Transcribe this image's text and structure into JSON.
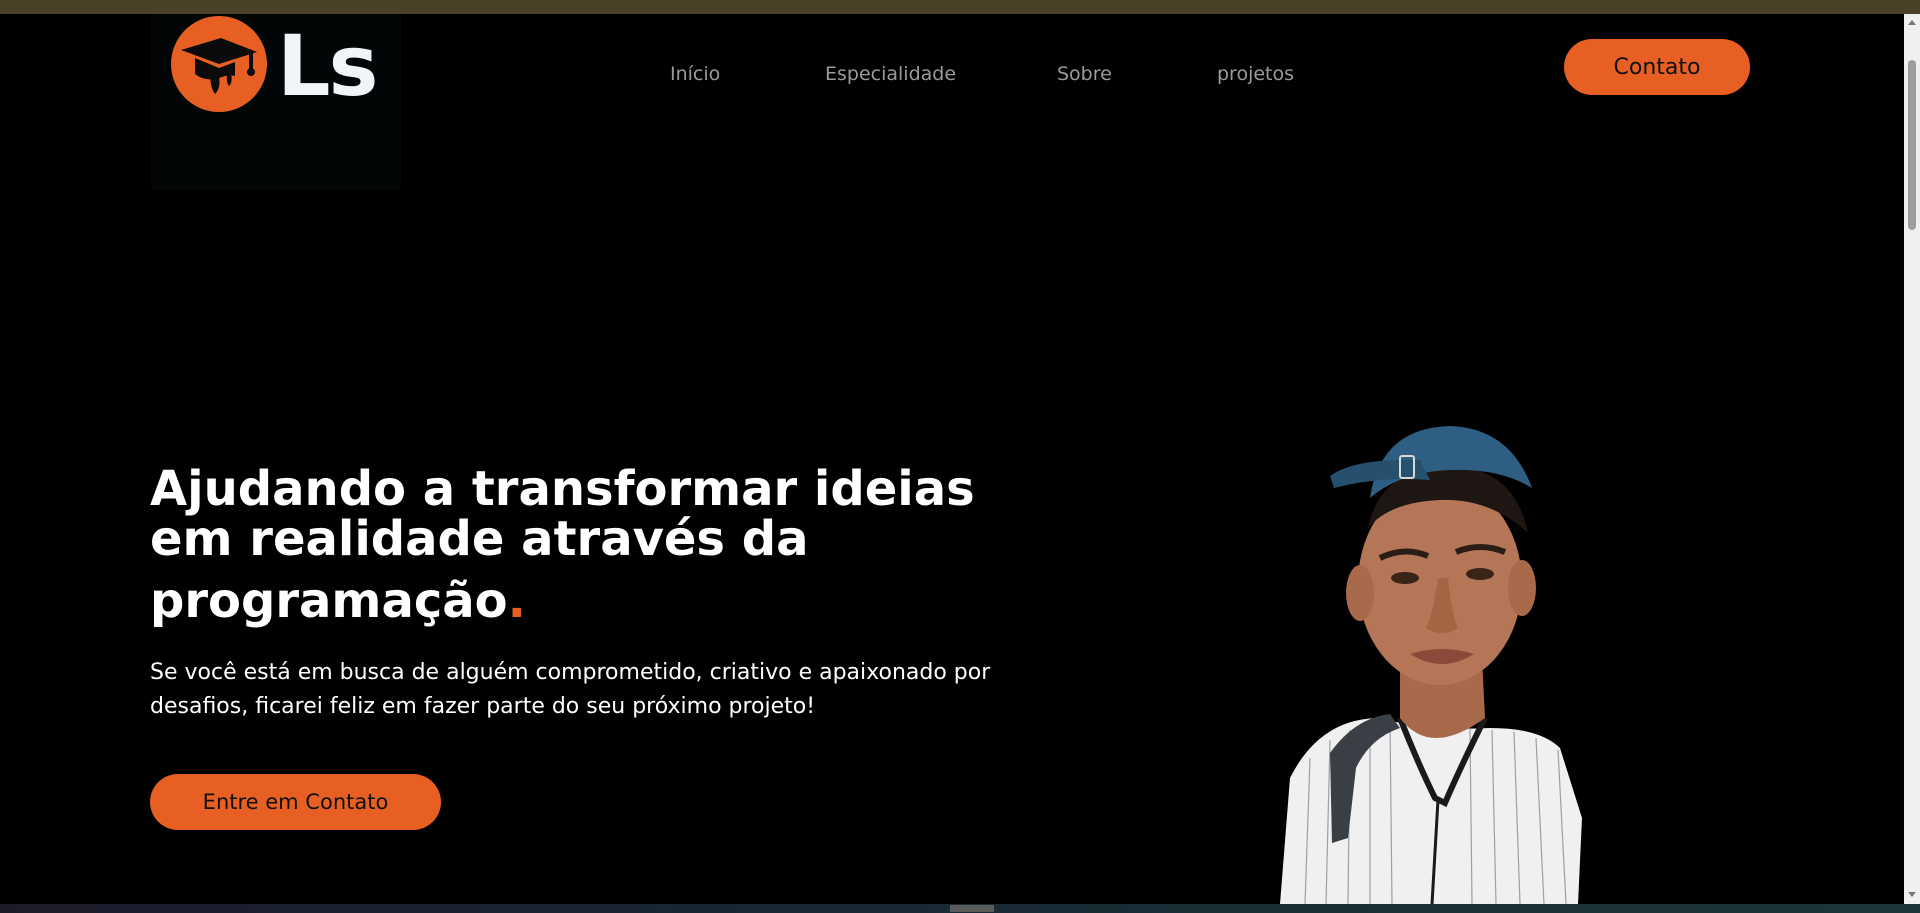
{
  "logo": {
    "icon": "graduation-cap-drip-icon",
    "text": "Ls"
  },
  "nav": {
    "items": [
      {
        "label": "Início"
      },
      {
        "label": "Especialidade"
      },
      {
        "label": "Sobre"
      },
      {
        "label": "projetos"
      }
    ],
    "contact_label": "Contato"
  },
  "hero": {
    "title_line1": "Ajudando a transformar ideias",
    "title_line2": "em realidade através da",
    "title_line3": "programação",
    "title_dot": ".",
    "subtitle": "Se você está em busca de alguém comprometido, criativo e apaixonado por desafios, ficarei feliz em fazer parte do seu próximo projeto!",
    "cta_label": "Entre em Contato",
    "portrait_icon": "person-portrait-icon"
  },
  "colors": {
    "accent": "#e85f24",
    "background": "#000000",
    "nav_text": "#9a9a9a",
    "heading": "#ffffff"
  }
}
